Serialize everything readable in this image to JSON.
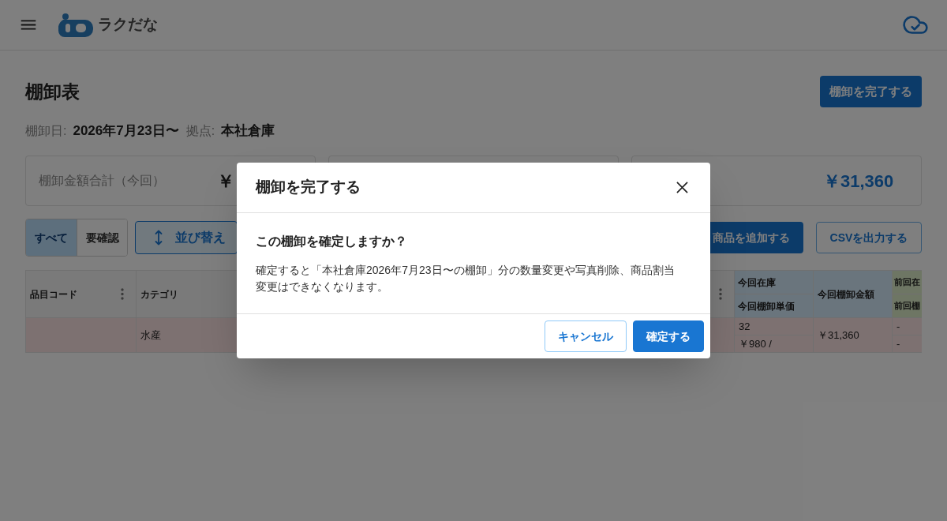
{
  "header": {
    "logo_text": "ラクだな"
  },
  "page": {
    "title": "棚卸表",
    "complete_button": "棚卸を完了する",
    "meta": [
      {
        "label": "棚卸日:",
        "value": "2026年7月23日〜"
      },
      {
        "label": "拠点:",
        "value": "本社倉庫"
      }
    ]
  },
  "summary_cards": [
    {
      "label": "棚卸金額合計（今回）",
      "value": "￥",
      "accent": false
    },
    {
      "value": "￥31,360",
      "accent": true
    }
  ],
  "toolbar": {
    "filters": [
      {
        "label": "すべて",
        "selected": true
      },
      {
        "label": "要確認",
        "selected": false
      }
    ],
    "sort_button": "並び替え",
    "add_button": "商品を追加する",
    "csv_button": "CSVを出力する"
  },
  "table": {
    "columns": [
      {
        "label": "品目コード",
        "kind": "plain",
        "menu": true
      },
      {
        "label": "カテゴリ",
        "kind": "plain",
        "menu": false
      },
      {
        "kind": "plain",
        "menu": true
      },
      {
        "label": "今回在庫",
        "sublabel": "今回棚卸単価",
        "kind": "current",
        "menu": false
      },
      {
        "label": "今回棚卸金額",
        "kind": "current",
        "menu": false
      },
      {
        "label": "前回在",
        "sublabel": "前回棚",
        "kind": "previous",
        "menu": false
      }
    ],
    "rows": [
      {
        "highlighted": true,
        "category": "水産",
        "current_stock": "32",
        "current_unit_price": "￥980 /",
        "current_amount": "￥31,360",
        "column_6_upper": "-",
        "column_6_lower": "-"
      }
    ]
  },
  "dialog": {
    "title": "棚卸を完了する",
    "question": "この棚卸を確定しますか？",
    "message": "確定すると「本社倉庫2026年7月23日〜の棚卸」分の数量変更や写真削除、商品割当変更はできなくなります。",
    "buttons": [
      {
        "label": "キャンセル",
        "kind": "secondary"
      },
      {
        "label": "確定する",
        "kind": "primary"
      }
    ]
  }
}
